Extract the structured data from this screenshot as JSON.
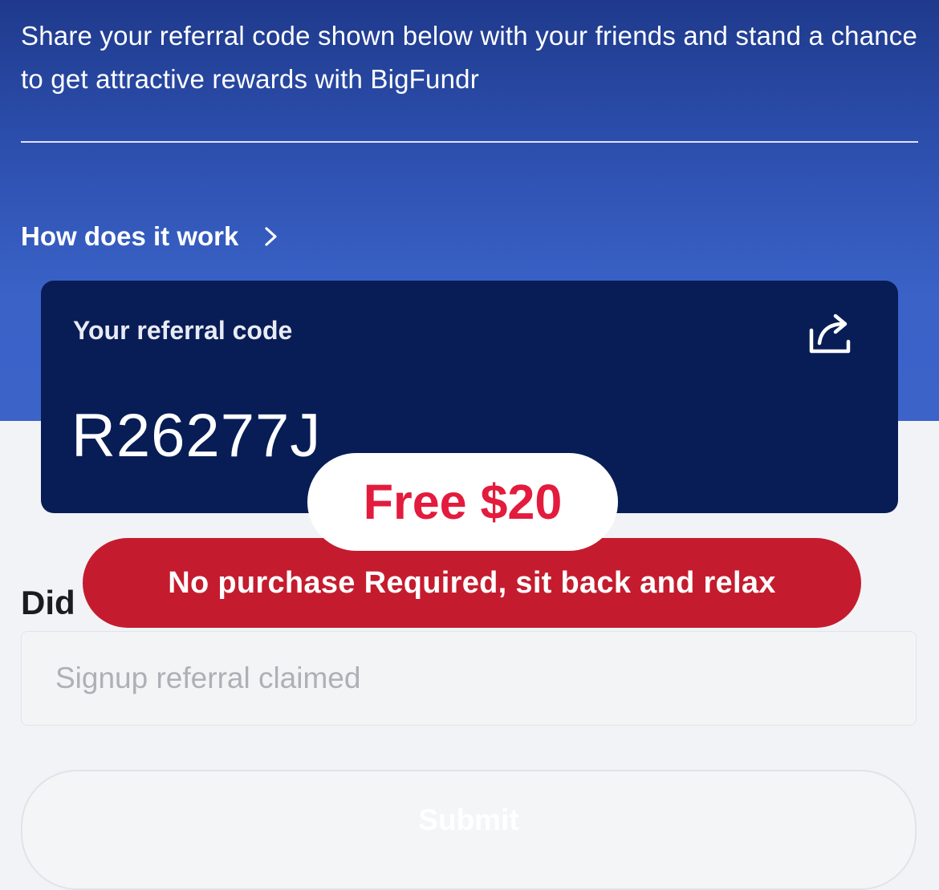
{
  "header": {
    "intro_text": "Share your referral code shown below with your friends and stand a chance to get attractive rewards with BigFundr",
    "how_link_label": "How does it work"
  },
  "referral_card": {
    "label": "Your referral code",
    "code": "R26277J",
    "share_icon": "share-icon"
  },
  "promo": {
    "headline": "Free $20",
    "tagline": "No purchase Required, sit back and relax"
  },
  "form": {
    "heading": "Did",
    "input_placeholder": "Signup referral claimed",
    "submit_label": "Submit"
  },
  "colors": {
    "hero_gradient_top": "#1f3a8c",
    "hero_gradient_bottom": "#3c63c8",
    "card_background": "#081d56",
    "promo_red": "#c41c2e",
    "promo_text_red": "#e31b3d",
    "page_background": "#f2f3f6"
  }
}
